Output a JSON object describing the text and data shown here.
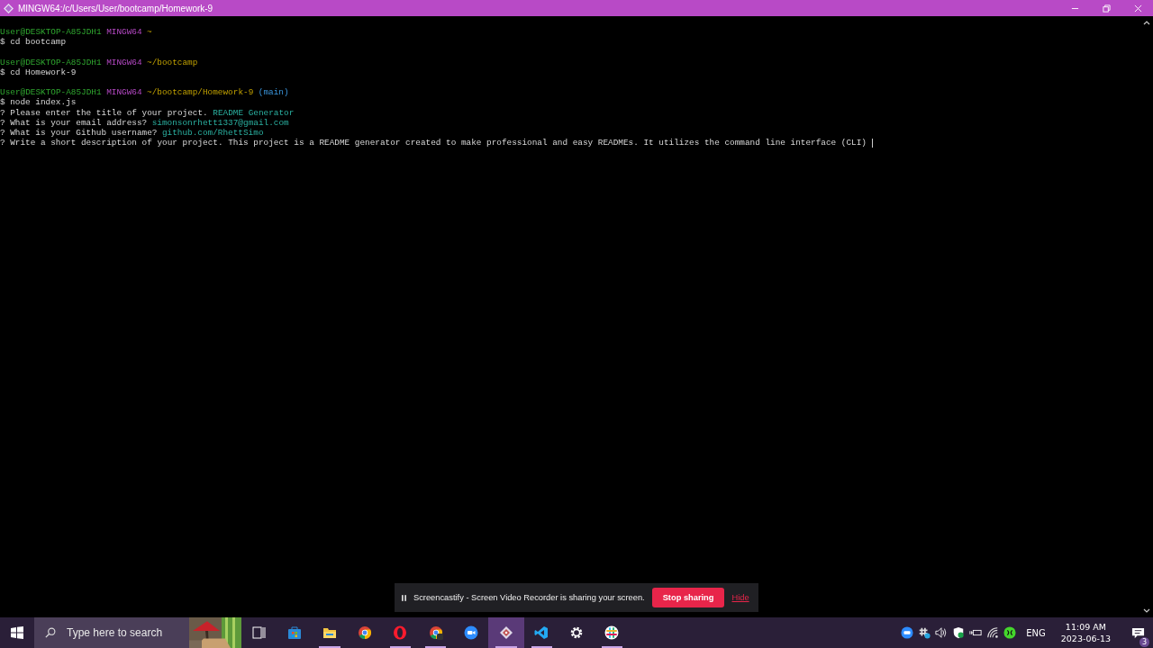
{
  "window": {
    "title": "MINGW64:/c/Users/User/bootcamp/Homework-9"
  },
  "terminal": {
    "lines": [
      {
        "kind": "prompt",
        "user": "User@DESKTOP-A85JDH1",
        "host": "MINGW64",
        "path": "~"
      },
      {
        "kind": "command",
        "sign": "$",
        "text": "cd bootcamp"
      },
      {
        "kind": "prompt",
        "user": "User@DESKTOP-A85JDH1",
        "host": "MINGW64",
        "path": "~/bootcamp"
      },
      {
        "kind": "command",
        "sign": "$",
        "text": "cd Homework-9"
      },
      {
        "kind": "prompt",
        "user": "User@DESKTOP-A85JDH1",
        "host": "MINGW64",
        "path": "~/bootcamp/Homework-9",
        "branch": "(main)"
      },
      {
        "kind": "command",
        "sign": "$",
        "text": "node index.js"
      },
      {
        "kind": "question",
        "sign": "?",
        "text": "Please enter the title of your project.",
        "answer": "README Generator"
      },
      {
        "kind": "question",
        "sign": "?",
        "text": "What is your email address?",
        "answer": "simonsonrhett1337@gmail.com"
      },
      {
        "kind": "question",
        "sign": "?",
        "text": "What is your Github username?",
        "answer": "github.com/RhettSimo"
      },
      {
        "kind": "input",
        "sign": "?",
        "text": "Write a short description of your project.",
        "value": "This project is a README generator created to make professional and easy READMEs. It utilizes the command line interface (CLI)"
      }
    ]
  },
  "share_bar": {
    "message": "Screencastify - Screen Video Recorder is sharing your screen.",
    "stop_button": "Stop sharing",
    "hide_link": "Hide"
  },
  "taskbar": {
    "search": {
      "placeholder": "Type here to search"
    },
    "apps": [
      {
        "kind": "taskview",
        "running": false,
        "active": false
      },
      {
        "kind": "store",
        "running": false,
        "active": false
      },
      {
        "kind": "explorer",
        "running": true,
        "active": false
      },
      {
        "kind": "chrome",
        "running": false,
        "active": false
      },
      {
        "kind": "opera",
        "running": true,
        "active": false
      },
      {
        "kind": "chrome-profile",
        "running": true,
        "active": false
      },
      {
        "kind": "zoom",
        "running": false,
        "active": false
      },
      {
        "kind": "git",
        "running": true,
        "active": true
      },
      {
        "kind": "vscode",
        "running": true,
        "active": false
      },
      {
        "kind": "settings",
        "running": false,
        "active": false
      },
      {
        "kind": "slack",
        "running": true,
        "active": false
      }
    ],
    "tray": {
      "language": "ENG",
      "time": "11:09 AM",
      "date": "2023-06-13",
      "notifications": "3"
    }
  }
}
